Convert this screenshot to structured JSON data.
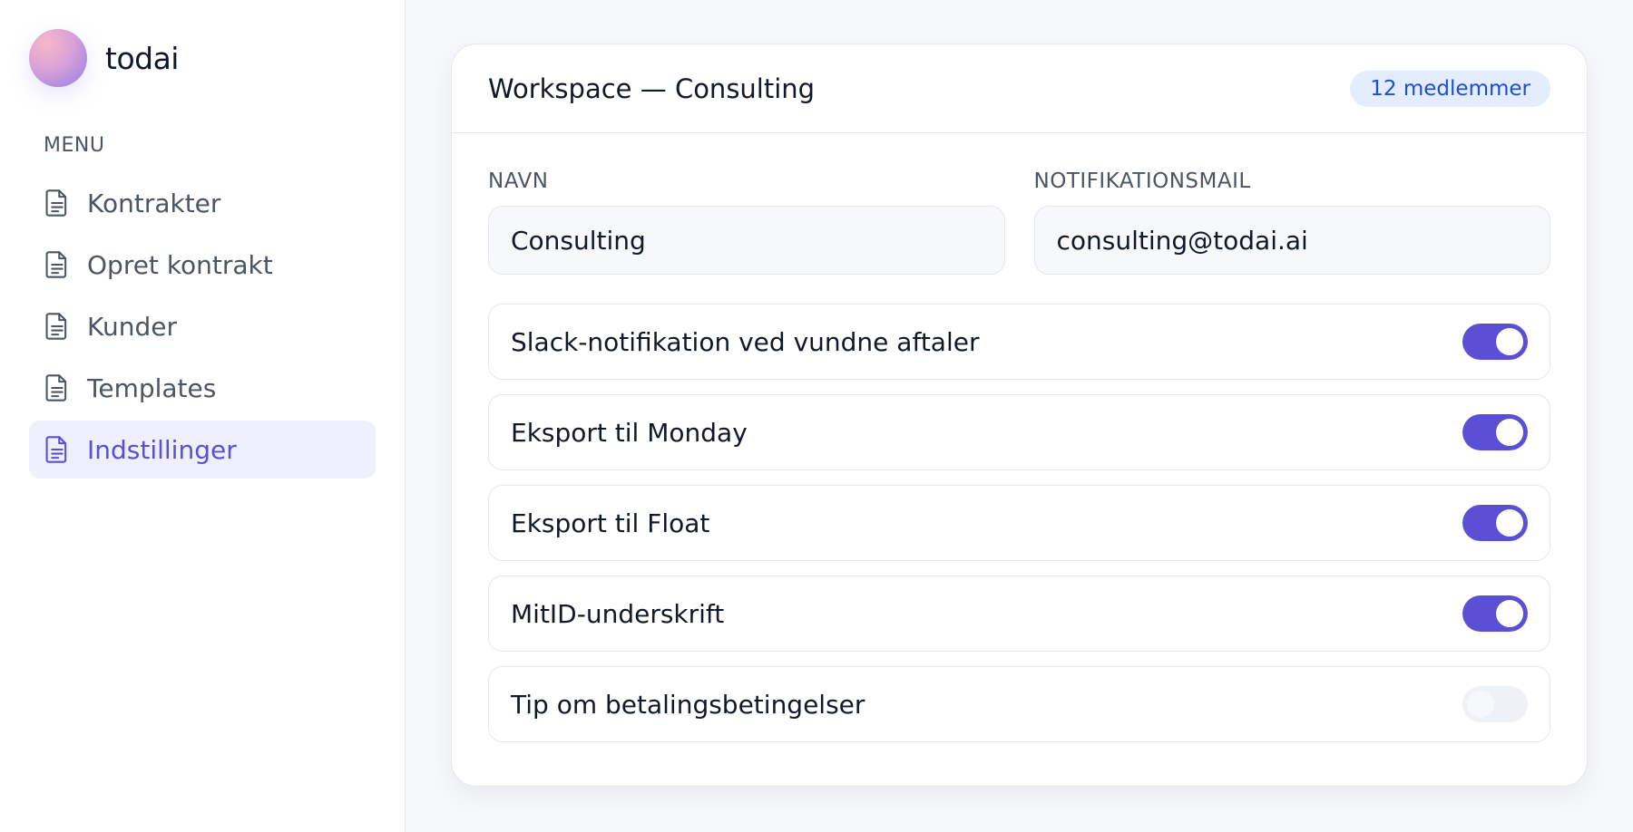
{
  "brand": {
    "name": "todai"
  },
  "sidebar": {
    "menu_label": "MENU",
    "items": [
      {
        "label": "Kontrakter",
        "icon": "document-icon",
        "active": false
      },
      {
        "label": "Opret kontrakt",
        "icon": "document-icon",
        "active": false
      },
      {
        "label": "Kunder",
        "icon": "document-icon",
        "active": false
      },
      {
        "label": "Templates",
        "icon": "document-icon",
        "active": false
      },
      {
        "label": "Indstillinger",
        "icon": "document-icon",
        "active": true
      }
    ]
  },
  "card": {
    "title": "Workspace — Consulting",
    "badge": "12 medlemmer",
    "fields": {
      "name_label": "NAVN",
      "name_value": "Consulting",
      "email_label": "NOTIFIKATIONSMAIL",
      "email_value": "consulting@todai.ai"
    },
    "toggles": [
      {
        "label": "Slack-notifikation ved vundne aftaler",
        "on": true
      },
      {
        "label": "Eksport til Monday",
        "on": true
      },
      {
        "label": "Eksport til Float",
        "on": true
      },
      {
        "label": "MitID-underskrift",
        "on": true
      },
      {
        "label": "Tip om betalingsbetingelser",
        "on": false
      }
    ]
  },
  "colors": {
    "accent": "#5b4fd6",
    "active_bg": "#eef0fd",
    "badge_bg": "#e3edfd",
    "badge_text": "#1d4ed8"
  }
}
